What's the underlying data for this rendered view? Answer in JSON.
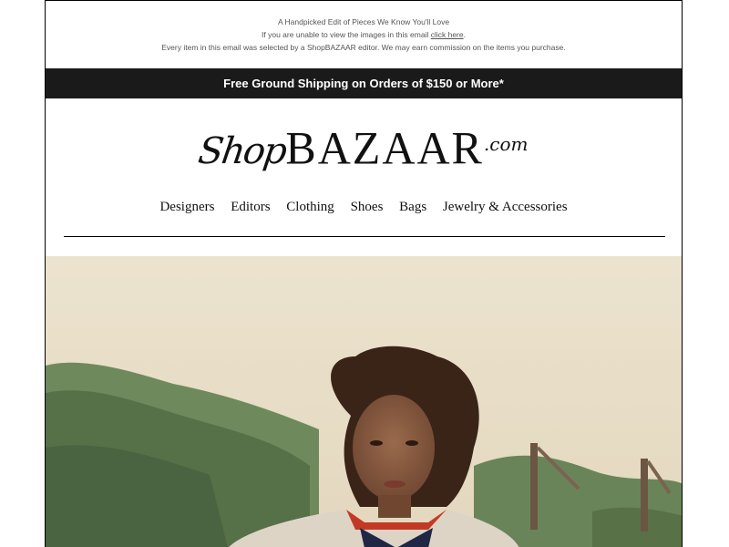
{
  "preheader": {
    "line1": "A Handpicked Edit of Pieces We Know You'll Love",
    "line2_prefix": "If you are unable to view the images in this email ",
    "line2_link": "click here",
    "line2_suffix": ".",
    "line3": "Every item in this email was selected by a ShopBAZAAR editor. We may earn commission on the items you purchase."
  },
  "shipping": {
    "text": "Free Ground Shipping on Orders of $150 or More*"
  },
  "logo": {
    "shop": "Shop",
    "bazaar": "BAZAAR",
    "com": ".com"
  },
  "nav": {
    "items": [
      "Designers",
      "Editors",
      "Clothing",
      "Shoes",
      "Bags",
      "Jewelry & Accessories"
    ]
  },
  "colors": {
    "shipping_bar": "#1a1a1a",
    "sand": "#e9e0cd",
    "foliage": "#5f7a52"
  }
}
